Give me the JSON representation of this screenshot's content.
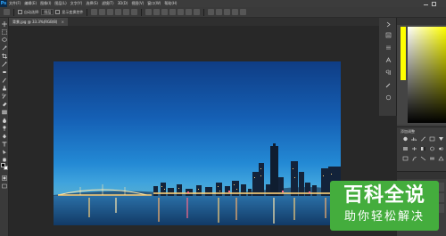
{
  "app": {
    "logo": "Ps"
  },
  "menu": [
    "文件(F)",
    "编辑(E)",
    "图像(I)",
    "图层(L)",
    "文字(Y)",
    "选择(S)",
    "滤镜(T)",
    "3D(D)",
    "视图(V)",
    "窗口(W)",
    "帮助(H)"
  ],
  "options_bar": {
    "auto_select_label": "自动选择:",
    "auto_select_value": "图层",
    "transform_label": "显示变换控件"
  },
  "document": {
    "tab_title": "背景.jpg @ 33.3%(RGB/8)",
    "close": "×"
  },
  "panels": {
    "adjustments_title": "添加调整"
  },
  "watermark": {
    "title": "百科全说",
    "subtitle": "助你轻松解决"
  },
  "colors": {
    "accent_green": "#44ad3d",
    "ps_blue": "#31a8ff"
  }
}
